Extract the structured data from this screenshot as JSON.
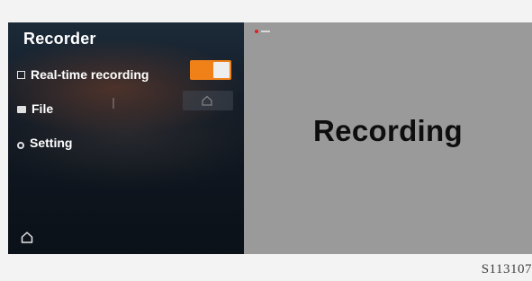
{
  "sidebar": {
    "title": "Recorder",
    "items": [
      {
        "label": "Real-time recording",
        "icon": "square-icon"
      },
      {
        "label": "File",
        "icon": "folder-icon"
      },
      {
        "label": "Setting",
        "icon": "gear-icon"
      }
    ],
    "toggle": {
      "state": "on",
      "color": "#f08018"
    },
    "home_icon": "home-icon"
  },
  "main": {
    "status_text": "Recording",
    "indicator_color": "#e02020"
  },
  "figure_code": "S113107"
}
